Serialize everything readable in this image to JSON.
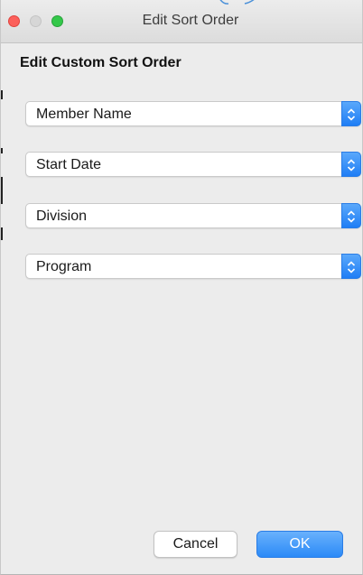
{
  "window": {
    "title": "Edit Sort Order"
  },
  "dialog": {
    "heading": "Edit Custom Sort Order"
  },
  "sort_fields": [
    {
      "label": "Member Name"
    },
    {
      "label": "Start Date"
    },
    {
      "label": "Division"
    },
    {
      "label": "Program"
    }
  ],
  "buttons": {
    "cancel_label": "Cancel",
    "ok_label": "OK"
  },
  "colors": {
    "accent": "#2b8af7",
    "close": "#fc605b",
    "zoom": "#34c84a"
  }
}
